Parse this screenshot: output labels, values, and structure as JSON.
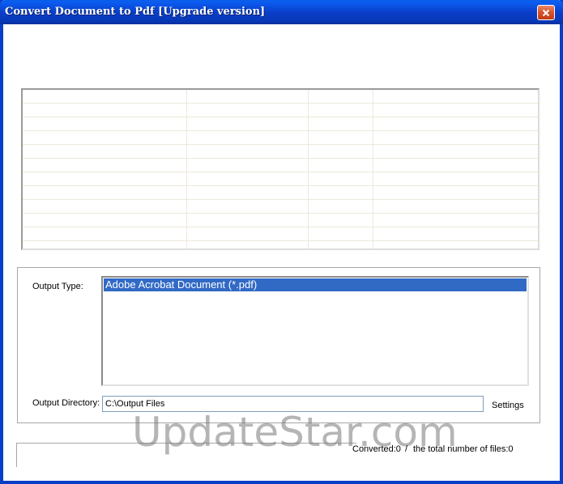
{
  "window": {
    "title": "Convert Document to Pdf [Upgrade version]"
  },
  "output": {
    "type_label": "Output Type:",
    "type_options": [
      "Adobe Acrobat Document (*.pdf)"
    ],
    "selected_type": "Adobe Acrobat Document (*.pdf)",
    "directory_label": "Output Directory:",
    "directory_value": "C:\\Output Files",
    "settings_label": "Settings"
  },
  "status": {
    "converted": "Converted:0",
    "separator": "/",
    "total": "the total number of files:0"
  },
  "watermark": "UpdateStar.com",
  "colors": {
    "title_bar": "#0a3fc9",
    "selection": "#316ac5",
    "close_button": "#d9542c"
  }
}
